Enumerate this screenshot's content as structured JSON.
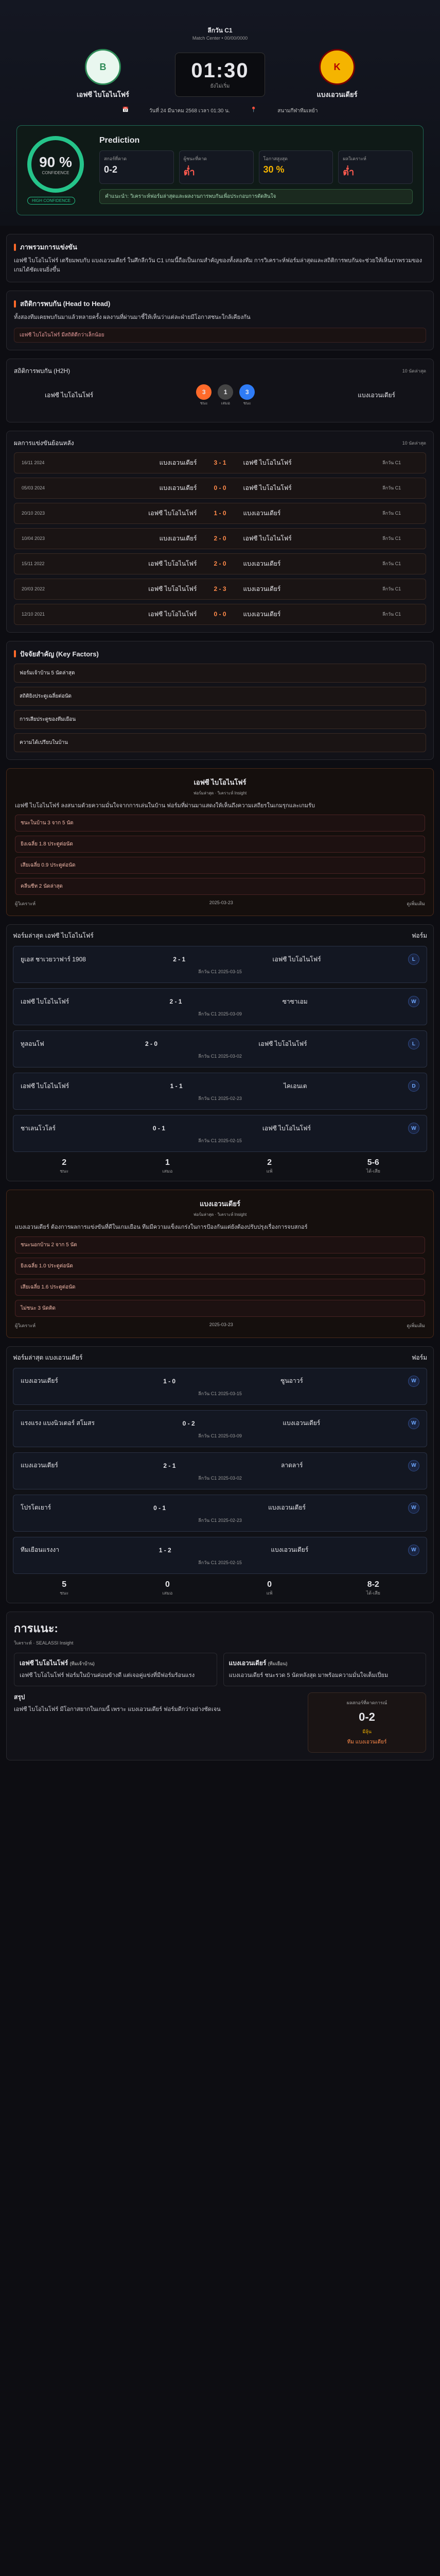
{
  "league": {
    "name": "ลีกวัน C1",
    "sub": "Match Center • 00/00/0000"
  },
  "home": {
    "name": "เอฟซี ไบโอไนโฟร์",
    "logo": "B"
  },
  "away": {
    "name": "แบงเอวนเดียร์",
    "logo": "K"
  },
  "kickoff": {
    "time": "01:30",
    "status": "ยังไม่เริ่ม"
  },
  "meta": {
    "date": "วันที่ 24 มีนาคม 2568 เวลา 01:30 น.",
    "venue": "สนามกีฬาทีมเหย้า"
  },
  "prediction": {
    "title": "Prediction",
    "percent": "90 %",
    "confidence": "CONFIDENCE",
    "badge": "HIGH CONFIDENCE",
    "stats": [
      {
        "k": "สกอร์ที่คาด",
        "v": "0-2"
      },
      {
        "k": "ผู้ชนะที่คาด",
        "v": "ต่ำ"
      },
      {
        "k": "โอกาสสูงสุด",
        "v": "30 %"
      },
      {
        "k": "ผลวิเคราะห์",
        "v": "ต่ำ"
      }
    ],
    "hint": "คำแนะนำ: วิเคราะห์ฟอร์มล่าสุดและผลงานการพบกันเพื่อประกอบการตัดสินใจ"
  },
  "overview": {
    "title": "ภาพรวมการแข่งขัน",
    "text": "เอฟซี ไบโอไนโฟร์ เตรียมพบกับ แบงเอวนเดียร์ ในศึกลีกวัน C1 เกมนี้ถือเป็นเกมสำคัญของทั้งสองทีม การวิเคราะห์ฟอร์มล่าสุดและสถิติการพบกันจะช่วยให้เห็นภาพรวมของเกมได้ชัดเจนยิ่งขึ้น"
  },
  "h2h": {
    "title": "สถิติการพบกัน (Head to Head)",
    "text": "ทั้งสองทีมเคยพบกันมาแล้วหลายครั้ง ผลงานที่ผ่านมาชี้ให้เห็นว่าแต่ละฝ่ายมีโอกาสชนะใกล้เคียงกัน",
    "note": "เอฟซี ไบโอไนโฟร์ มีสถิติดีกว่าเล็กน้อย",
    "countTitle": "สถิติการพบกัน (H2H)",
    "countSub": "10 นัดล่าสุด",
    "home": "3",
    "draw": "1",
    "away": "3",
    "lblH": "ชนะ",
    "lblD": "เสมอ",
    "lblA": "ชนะ",
    "listTitle": "ผลการแข่งขันย้อนหลัง",
    "listSub": "10 นัดล่าสุด",
    "rows": [
      {
        "d": "16/11 2024",
        "h": "แบงเอวนเดียร์",
        "s": "3 - 1",
        "a": "เอฟซี ไบโอไนโฟร์",
        "l": "ลีกวัน C1"
      },
      {
        "d": "05/03 2024",
        "h": "แบงเอวนเดียร์",
        "s": "0 - 0",
        "a": "เอฟซี ไบโอไนโฟร์",
        "l": "ลีกวัน C1"
      },
      {
        "d": "20/10 2023",
        "h": "เอฟซี ไบโอไนโฟร์",
        "s": "1 - 0",
        "a": "แบงเอวนเดียร์",
        "l": "ลีกวัน C1"
      },
      {
        "d": "10/04 2023",
        "h": "แบงเอวนเดียร์",
        "s": "2 - 0",
        "a": "เอฟซี ไบโอไนโฟร์",
        "l": "ลีกวัน C1"
      },
      {
        "d": "15/11 2022",
        "h": "เอฟซี ไบโอไนโฟร์",
        "s": "2 - 0",
        "a": "แบงเอวนเดียร์",
        "l": "ลีกวัน C1"
      },
      {
        "d": "20/03 2022",
        "h": "เอฟซี ไบโอไนโฟร์",
        "s": "2 - 3",
        "a": "แบงเอวนเดียร์",
        "l": "ลีกวัน C1"
      },
      {
        "d": "12/10 2021",
        "h": "เอฟซี ไบโอไนโฟร์",
        "s": "0 - 0",
        "a": "แบงเอวนเดียร์",
        "l": "ลีกวัน C1"
      }
    ]
  },
  "keyfactors": {
    "title": "ปัจจัยสำคัญ (Key Factors)",
    "items": [
      "ฟอร์มเจ้าบ้าน 5 นัดล่าสุด",
      "สถิติยิงประตูเฉลี่ยต่อนัด",
      "การเสียประตูของทีมเยือน",
      "ความได้เปรียบในบ้าน"
    ]
  },
  "homecard": {
    "name": "เอฟซี ไบโอไนโฟร์",
    "tag1": "ฟอร์มล่าสุด",
    "tag2": "วิเคราะห์ Insight",
    "text": "เอฟซี ไบโอไนโฟร์ ลงสนามด้วยความมั่นใจจากการเล่นในบ้าน ฟอร์มที่ผ่านมาแสดงให้เห็นถึงความเสถียรในเกมรุกและเกมรับ",
    "items": [
      "ชนะในบ้าน 3 จาก 5 นัด",
      "ยิงเฉลี่ย 1.8 ประตูต่อนัด",
      "เสียเฉลี่ย 0.9 ประตูต่อนัด",
      "คลีนชีท 2 นัดล่าสุด"
    ],
    "author": "ผู้วิเคราะห์",
    "date": "2025-03-23",
    "more": "ดูเพิ่มเติม"
  },
  "homeform": {
    "title": "ฟอร์มล่าสุด เอฟซี ไบโอไนโฟร์",
    "label": "ฟอร์ม",
    "wl": [
      "L",
      "L",
      "W",
      "L"
    ],
    "matches": [
      {
        "h": "ยูเอส ชาเวยวาฟาร์ 1908",
        "s": "2 - 1",
        "a": "เอฟซี ไบโอไนโฟร์",
        "l": "ลีกวัน C1",
        "dt": "2025-03-15",
        "r": "L"
      },
      {
        "h": "เอฟซี ไบโอไนโฟร์",
        "s": "2 - 1",
        "a": "ซาซาเอม",
        "l": "ลีกวัน C1",
        "dt": "2025-03-09",
        "r": "W"
      },
      {
        "h": "ทูลอนโฟ",
        "s": "2 - 0",
        "a": "เอฟซี ไบโอไนโฟร์",
        "l": "ลีกวัน C1",
        "dt": "2025-03-02",
        "r": "L"
      },
      {
        "h": "เอฟซี ไบโอไนโฟร์",
        "s": "1 - 1",
        "a": "ไคเอนเต",
        "l": "ลีกวัน C1",
        "dt": "2025-02-23",
        "r": "D"
      },
      {
        "h": "ชาเลนโวโลร์",
        "s": "0 - 1",
        "a": "เอฟซี ไบโอไนโฟร์",
        "l": "ลีกวัน C1",
        "dt": "2025-02-15",
        "r": "W"
      }
    ],
    "sum": [
      {
        "n": "2",
        "l": "ชนะ"
      },
      {
        "n": "1",
        "l": "เสมอ"
      },
      {
        "n": "2",
        "l": "แพ้"
      },
      {
        "n": "5-6",
        "l": "ได้-เสีย"
      }
    ]
  },
  "awaycard": {
    "name": "แบงเอวนเดียร์",
    "tag1": "ฟอร์มล่าสุด",
    "tag2": "วิเคราะห์ Insight",
    "text": "แบงเอวนเดียร์ ต้องการผลการแข่งขันที่ดีในเกมเยือน ทีมมีความแข็งแกร่งในการป้องกันแต่ยังต้องปรับปรุงเรื่องการจบสกอร์",
    "items": [
      "ชนะนอกบ้าน 2 จาก 5 นัด",
      "ยิงเฉลี่ย 1.0 ประตูต่อนัด",
      "เสียเฉลี่ย 1.6 ประตูต่อนัด",
      "ไม่ชนะ 3 นัดติด"
    ],
    "author": "ผู้วิเคราะห์",
    "date": "2025-03-23",
    "more": "ดูเพิ่มเติม"
  },
  "awayform": {
    "title": "ฟอร์มล่าสุด แบงเอวนเดียร์",
    "label": "ฟอร์ม",
    "wl": [
      "L",
      "L",
      "L",
      "L"
    ],
    "matches": [
      {
        "h": "แบงเอวนเดียร์",
        "s": "1 - 0",
        "a": "ซูนอาวร์",
        "l": "ลีกวัน C1",
        "dt": "2025-03-15",
        "r": "W"
      },
      {
        "h": "แรงแรง แบงนิวเตอร์ สโมสร",
        "s": "0 - 2",
        "a": "แบงเอวนเดียร์",
        "l": "ลีกวัน C1",
        "dt": "2025-03-09",
        "r": "W"
      },
      {
        "h": "แบงเอวนเดียร์",
        "s": "2 - 1",
        "a": "ลาดลาร์",
        "l": "ลีกวัน C1",
        "dt": "2025-03-02",
        "r": "W"
      },
      {
        "h": "โปรโตเยาร์",
        "s": "0 - 1",
        "a": "แบงเอวนเดียร์",
        "l": "ลีกวัน C1",
        "dt": "2025-02-23",
        "r": "W"
      },
      {
        "h": "ทีมเยือนแรงงา",
        "s": "1 - 2",
        "a": "แบงเอวนเดียร์",
        "l": "ลีกวัน C1",
        "dt": "2025-02-15",
        "r": "W"
      }
    ],
    "sum": [
      {
        "n": "5",
        "l": "ชนะ"
      },
      {
        "n": "0",
        "l": "เสมอ"
      },
      {
        "n": "0",
        "l": "แพ้"
      },
      {
        "n": "8-2",
        "l": "ได้-เสีย"
      }
    ]
  },
  "analysis": {
    "title": "การแนะ:",
    "tag1": "วิเคราะห์",
    "tag2": "SEALASSI Insight",
    "homeName": "เอฟซี ไบโอไนโฟร์",
    "homeSub": "(ทีมเจ้าบ้าน)",
    "homeText": "เอฟซี ไบโอไนโฟร์ ฟอร์มในบ้านค่อนข้างดี แต่เจอคู่แข่งที่มีฟอร์มร้อนแรง",
    "awayName": "แบงเอวนเดียร์",
    "awaySub": "(ทีมเยือน)",
    "awayText": "แบงเอวนเดียร์ ชนะรวด 5 นัดหลังสุด มาพร้อมความมั่นใจเต็มเปี่ยม",
    "finalTitle": "สรุป",
    "finalText": "เอฟซี ไบโอไนโฟร์ มีโอกาสยากในเกมนี้ เพราะ แบงเอวนเดียร์ ฟอร์มดีกว่าอย่างชัดเจน",
    "predTitle": "ผลสกอร์ที่คาดการณ์",
    "predScore": "0-2",
    "predTag": "มีลุ้น",
    "predSub": "ทีม แบงเอวนเดียร์"
  }
}
